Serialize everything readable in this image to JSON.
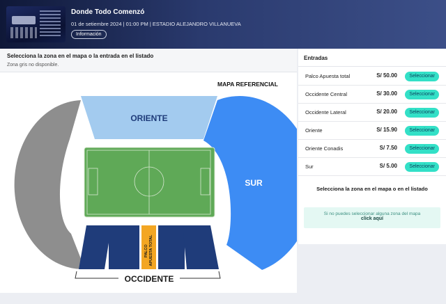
{
  "event": {
    "title": "Donde Todo Comenzó",
    "subtitle": "01 de setiembre 2024 | 01:00 PM | ESTADIO ALEJANDRO VILLANUEVA",
    "info_button": "Información",
    "poster_icon": "event-poster-image"
  },
  "map": {
    "instruction": "Selecciona la zona en el mapa o la entrada en el listado",
    "note": "Zona gris no disponible.",
    "title": "MAPA REFERENCIAL",
    "zones": {
      "oriente": "ORIENTE",
      "sur": "SUR",
      "occidente": "OCCIDENTE",
      "palco_line1": "PALCO",
      "palco_line2": "APUESTA TOTAL"
    }
  },
  "entradas": {
    "title": "Entradas",
    "items": [
      {
        "name": "Palco Apuesta total",
        "price": "S/ 50.00",
        "button": "Seleccionar"
      },
      {
        "name": "Occidente Central",
        "price": "S/ 30.00",
        "button": "Seleccionar"
      },
      {
        "name": "Occidente Lateral",
        "price": "S/ 20.00",
        "button": "Seleccionar"
      },
      {
        "name": "Oriente",
        "price": "S/ 15.90",
        "button": "Seleccionar"
      },
      {
        "name": "Oriente Conadis",
        "price": "S/ 7.50",
        "button": "Seleccionar"
      },
      {
        "name": "Sur",
        "price": "S/ 5.00",
        "button": "Seleccionar"
      }
    ],
    "select_message": "Selecciona la zona en el mapa o en el listado",
    "help_text": "Si no puedes seleccionar alguna zona del mapa",
    "help_link": "click aquí"
  },
  "colors": {
    "accent_button": "#33e0c7",
    "sur_zone": "#3d8cf4",
    "oriente_zone": "#a3cbef",
    "occidente_zone": "#1f3c7a",
    "palco_zone": "#f3a623",
    "unavailable_zone": "#8e8e8e",
    "field": "#5fa957"
  }
}
